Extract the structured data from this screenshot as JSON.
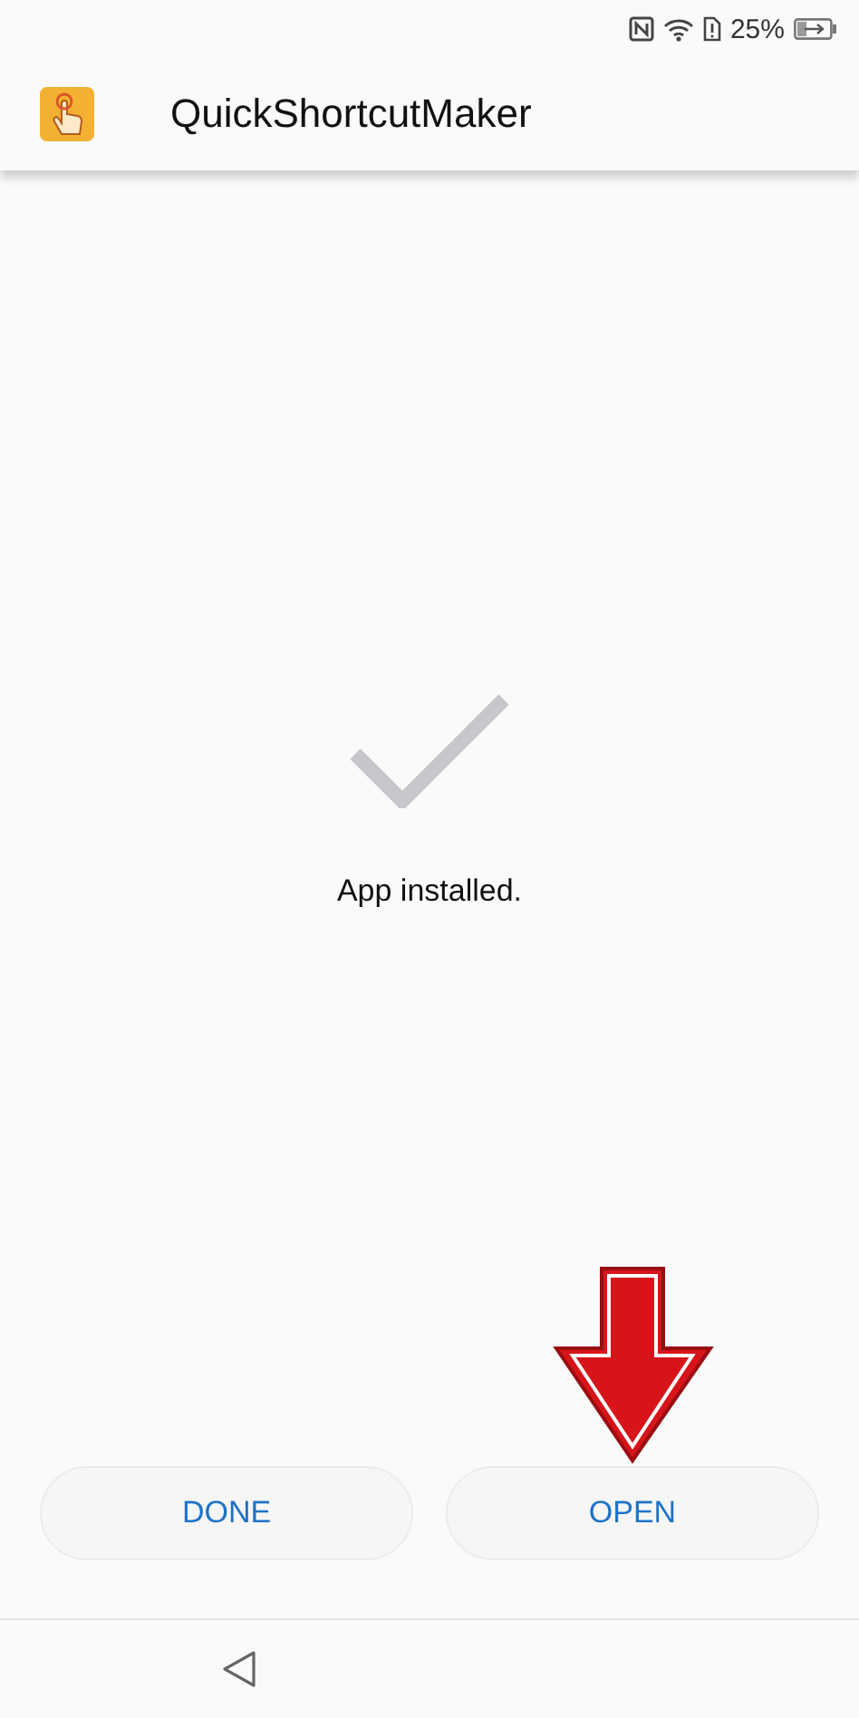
{
  "status_bar": {
    "battery_percent": "25%"
  },
  "app_bar": {
    "title": "QuickShortcutMaker"
  },
  "message": "App installed.",
  "buttons": [
    {
      "label": "DONE"
    },
    {
      "label": "OPEN"
    }
  ]
}
